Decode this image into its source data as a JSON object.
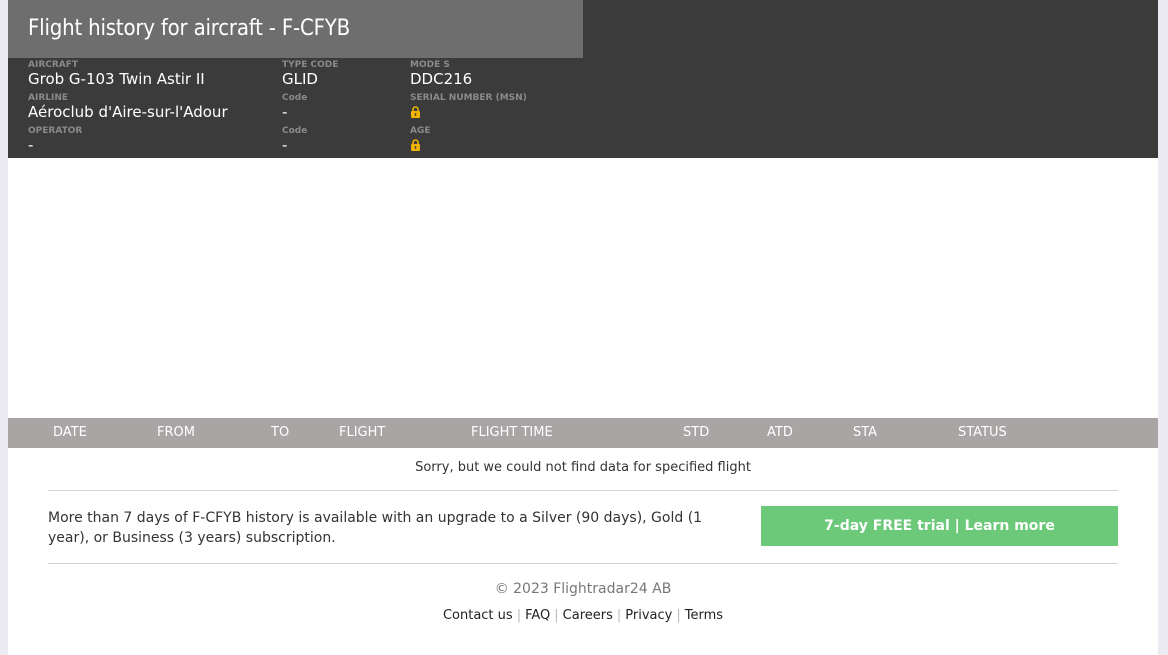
{
  "header": {
    "title": "Flight history for aircraft - F-CFYB",
    "aircraft_label": "AIRCRAFT",
    "aircraft_value": "Grob G-103 Twin Astir II",
    "type_code_label": "TYPE CODE",
    "type_code_value": "GLID",
    "mode_s_label": "MODE S",
    "mode_s_value": "DDC216",
    "airline_label": "AIRLINE",
    "airline_value": "Aéroclub d'Aire-sur-l'Adour",
    "airline_code_label": "Code",
    "airline_code_value": "-",
    "serial_label": "SERIAL NUMBER (MSN)",
    "operator_label": "OPERATOR",
    "operator_value": "-",
    "operator_code_label": "Code",
    "operator_code_value": "-",
    "age_label": "AGE",
    "lock_icon": "lock-icon",
    "lock_color": "#f0b400"
  },
  "table": {
    "columns": [
      "DATE",
      "FROM",
      "TO",
      "FLIGHT",
      "FLIGHT TIME",
      "STD",
      "ATD",
      "STA",
      "STATUS"
    ],
    "empty_message": "Sorry, but we could not find data for specified flight"
  },
  "upsell": {
    "text": "More than 7 days of F-CFYB history is available with an upgrade to a Silver (90 days), Gold (1 year), or Business (3 years) subscription.",
    "button_label": "7-day FREE trial | Learn more",
    "button_color": "#6cc97a"
  },
  "footer": {
    "copyright": "© 2023 Flightradar24 AB",
    "links": [
      "Contact us",
      "FAQ",
      "Careers",
      "Privacy",
      "Terms"
    ]
  },
  "colors": {
    "header_bg": "#3b3b3b",
    "title_bg": "#6e6e6e",
    "table_header_bg": "#a9a5a5"
  }
}
